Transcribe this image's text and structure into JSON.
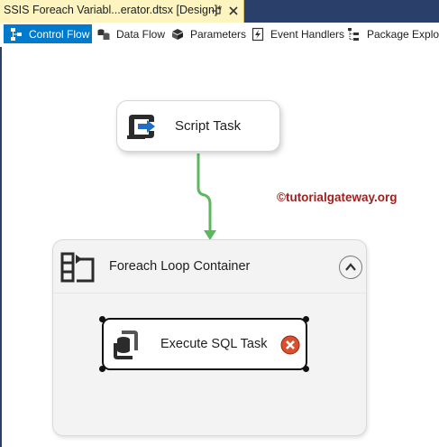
{
  "document_tab": {
    "title": "SSIS Foreach Variabl...erator.dtsx [Design]*"
  },
  "designer_tabs": [
    {
      "label": "Control Flow",
      "icon": "control-flow-icon",
      "active": true
    },
    {
      "label": "Data Flow",
      "icon": "data-flow-icon",
      "active": false
    },
    {
      "label": "Parameters",
      "icon": "parameters-icon",
      "active": false
    },
    {
      "label": "Event Handlers",
      "icon": "event-handlers-icon",
      "active": false
    },
    {
      "label": "Package Explorer",
      "icon": "package-explorer-icon",
      "active": false
    }
  ],
  "canvas": {
    "watermark": "©tutorialgateway.org",
    "script_task": {
      "label": "Script Task",
      "icon": "script-task-icon"
    },
    "foreach_container": {
      "label": "Foreach Loop Container",
      "icon": "foreach-loop-icon",
      "collapse_icon": "chevron-up-icon"
    },
    "execute_sql_task": {
      "label": "Execute SQL Task",
      "icon": "execute-sql-icon",
      "status_icon": "error-icon"
    }
  },
  "colors": {
    "active_tab": "#007acc",
    "document_tab": "#fdf4bf",
    "precedence_success": "#5cb85c",
    "error": "#d9502f",
    "watermark": "#a02020"
  }
}
